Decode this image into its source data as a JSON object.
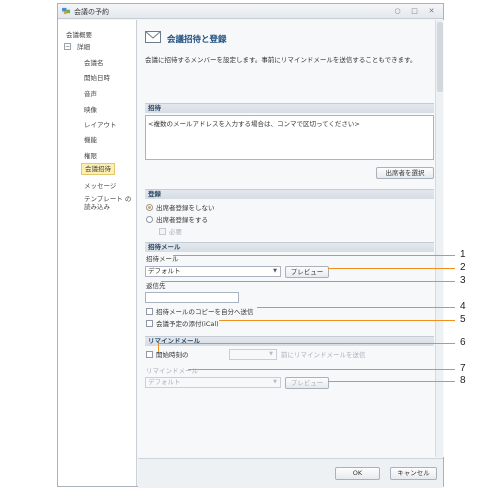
{
  "window": {
    "title": "会議の予約",
    "minimize": "○",
    "maximize": "□",
    "close": "✕"
  },
  "sidebar": {
    "items": [
      {
        "label": "会議概要"
      },
      {
        "label": "詳細"
      },
      {
        "label": "会議名"
      },
      {
        "label": "開始日時"
      },
      {
        "label": "音声"
      },
      {
        "label": "映像"
      },
      {
        "label": "レイアウト"
      },
      {
        "label": "機能"
      },
      {
        "label": "権限"
      },
      {
        "label": "会議招待"
      },
      {
        "label": "メッセージ"
      },
      {
        "label": "テンプレート の読み込み"
      }
    ],
    "toggle": "−"
  },
  "header": {
    "title": "会議招待と登録",
    "description": "会議に招待するメンバーを設定します。事前にリマインドメールを送信することもできます。"
  },
  "invite": {
    "section": "招待",
    "textarea_text": "<複数のメールアドレスを入力する場合は、コンマで区切ってください>",
    "select_attendees": "出席者を選択"
  },
  "registration": {
    "section": "登録",
    "no_registration": "出席者登録をしない",
    "require_registration": "出席者登録をする",
    "required": "必要"
  },
  "invite_mail": {
    "section": "招待メール",
    "template_label": "招待メール",
    "template_value": "デフォルト",
    "preview": "プレビュー",
    "reply_to_label": "返信先",
    "reply_to_value": "",
    "copy_to_self": "招待メールのコピーを自分へ送信",
    "attach_ical": "会議予定の添付(iCal)"
  },
  "reminder": {
    "section": "リマインドメール",
    "before_start": "開始時刻の",
    "offset_value": "",
    "suffix": "前にリマインドメールを送信",
    "template_label": "リマインドメール",
    "template_value": "デフォルト",
    "preview": "プレビュー"
  },
  "footer": {
    "ok": "OK",
    "cancel": "キャンセル"
  },
  "callouts": [
    "1",
    "2",
    "3",
    "4",
    "5",
    "6",
    "7",
    "8"
  ],
  "colors": {
    "callout": "#f0901e",
    "selected_bg": "#fbefb4",
    "title": "#1d4e7e",
    "radio_checked": "#e3a33a"
  }
}
